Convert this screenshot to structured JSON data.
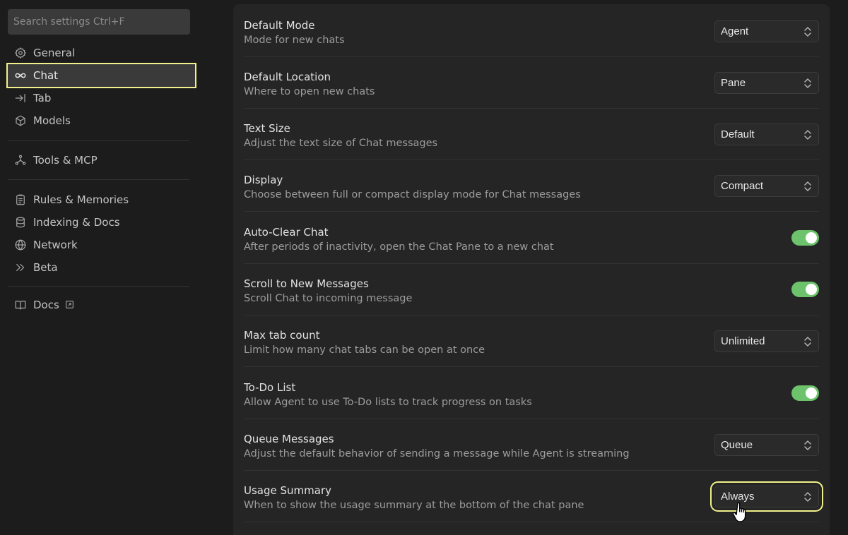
{
  "sidebar": {
    "search_placeholder": "Search settings Ctrl+F",
    "items": [
      {
        "label": "General",
        "icon": "gear-icon"
      },
      {
        "label": "Chat",
        "icon": "infinity-icon",
        "active": true
      },
      {
        "label": "Tab",
        "icon": "arrow-right-bar-icon"
      },
      {
        "label": "Models",
        "icon": "cube-icon"
      },
      {
        "label": "Tools & MCP",
        "icon": "network-nodes-icon"
      },
      {
        "label": "Rules & Memories",
        "icon": "clipboard-icon"
      },
      {
        "label": "Indexing & Docs",
        "icon": "database-icon"
      },
      {
        "label": "Network",
        "icon": "globe-icon"
      },
      {
        "label": "Beta",
        "icon": "double-chevron-right-icon"
      },
      {
        "label": "Docs",
        "icon": "book-icon",
        "external_icon": "external-link-icon"
      }
    ]
  },
  "settings": [
    {
      "title": "Default Mode",
      "description": "Mode for new chats",
      "control": "select",
      "value": "Agent"
    },
    {
      "title": "Default Location",
      "description": "Where to open new chats",
      "control": "select",
      "value": "Pane"
    },
    {
      "title": "Text Size",
      "description": "Adjust the text size of Chat messages",
      "control": "select",
      "value": "Default"
    },
    {
      "title": "Display",
      "description": "Choose between full or compact display mode for Chat messages",
      "control": "select",
      "value": "Compact"
    },
    {
      "title": "Auto-Clear Chat",
      "description": "After periods of inactivity, open the Chat Pane to a new chat",
      "control": "toggle",
      "value": true
    },
    {
      "title": "Scroll to New Messages",
      "description": "Scroll Chat to incoming message",
      "control": "toggle",
      "value": true
    },
    {
      "title": "Max tab count",
      "description": "Limit how many chat tabs can be open at once",
      "control": "select",
      "value": "Unlimited"
    },
    {
      "title": "To-Do List",
      "description": "Allow Agent to use To-Do lists to track progress on tasks",
      "control": "toggle",
      "value": true
    },
    {
      "title": "Queue Messages",
      "description": "Adjust the default behavior of sending a message while Agent is streaming",
      "control": "select",
      "value": "Queue"
    },
    {
      "title": "Usage Summary",
      "description": "When to show the usage summary at the bottom of the chat pane",
      "control": "select",
      "value": "Always"
    }
  ],
  "colors": {
    "accent_highlight": "#f1f08a",
    "toggle_on": "#6cc36c",
    "background": "#1c1c1c",
    "panel": "#252525"
  }
}
